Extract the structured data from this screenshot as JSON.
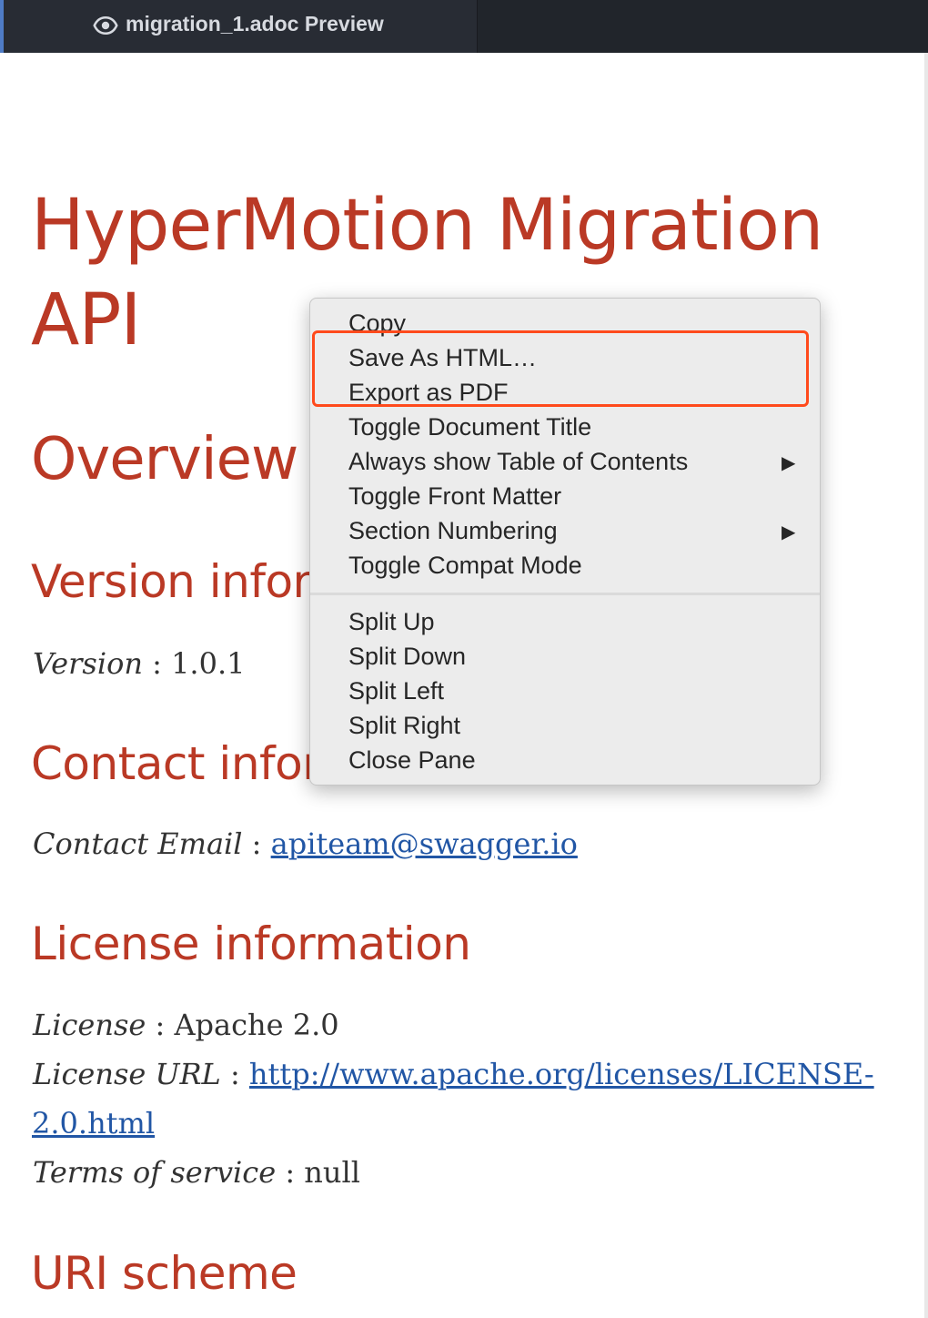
{
  "tab": {
    "title": "migration_1.adoc Preview",
    "icon": "eye-icon"
  },
  "document": {
    "title_line1": "HyperMotion Migration",
    "title_line2": "API",
    "overview_heading": "Overview",
    "version_heading": "Version infor",
    "version_label": "Version",
    "version_value": " : 1.0.1",
    "contact_heading": "Contact infor",
    "contact_label": "Contact Email",
    "contact_sep": " : ",
    "contact_email": "apiteam@swagger.io",
    "license_heading": "License information",
    "license_label": "License",
    "license_value": " : Apache 2.0",
    "license_url_label": "License URL",
    "license_url_sep": " : ",
    "license_url_line1": "http://www.apache.org/licenses/LICENSE-",
    "license_url_line2": "2.0.html",
    "tos_label": "Terms of service",
    "tos_value": " : null",
    "uri_heading": "URI scheme"
  },
  "context_menu": {
    "items": [
      "Copy",
      "Save As HTML…",
      "Export as PDF",
      "Toggle Document Title",
      "Always show Table of Contents",
      "Toggle Front Matter",
      "Section Numbering",
      "Toggle Compat Mode",
      "Split Up",
      "Split Down",
      "Split Left",
      "Split Right",
      "Close Pane"
    ],
    "submenu_arrow": "▶"
  },
  "colors": {
    "heading": "#ba3925",
    "link": "#2156a5",
    "highlight_box": "#ff4a1c",
    "tabbar": "#21252b"
  }
}
